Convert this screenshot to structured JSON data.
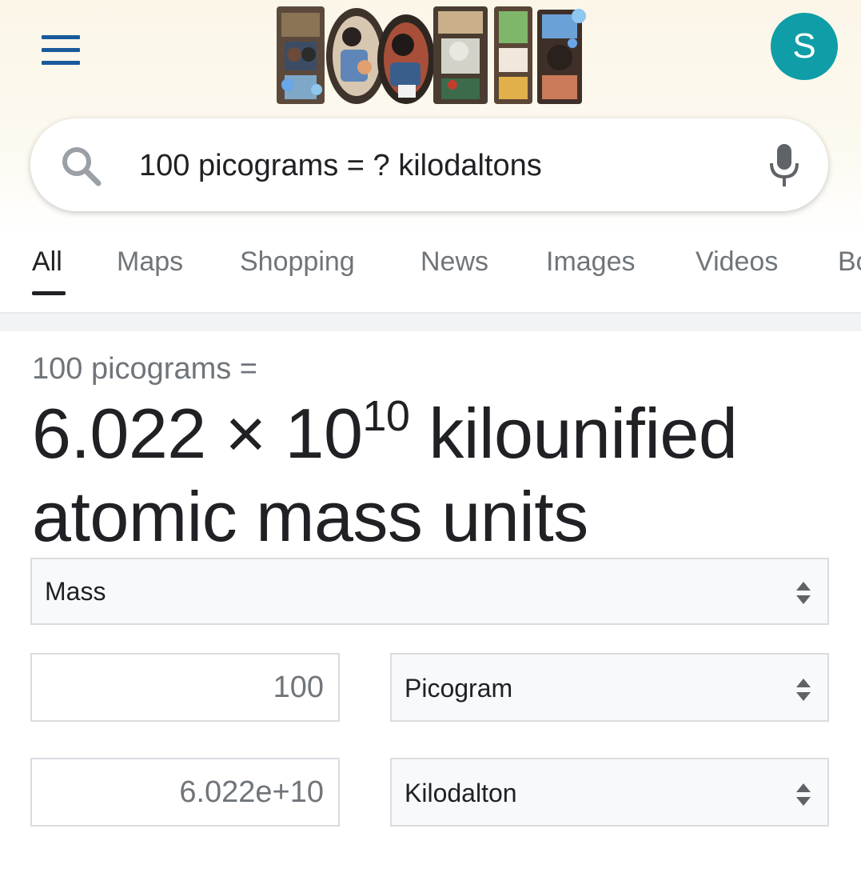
{
  "header": {
    "avatar_letter": "S"
  },
  "search": {
    "query": "100 picograms = ? kilodaltons"
  },
  "tabs": [
    {
      "label": "All"
    },
    {
      "label": "Maps"
    },
    {
      "label": "Shopping"
    },
    {
      "label": "News"
    },
    {
      "label": "Images"
    },
    {
      "label": "Videos"
    },
    {
      "label": "Bo"
    }
  ],
  "converter": {
    "result_label": "100 picograms =",
    "result_mantissa": "6.022 × 10",
    "result_exponent": "10",
    "result_unit_line1": " kilounified",
    "result_unit_line2": "atomic mass units",
    "category": "Mass",
    "from_value": "100",
    "from_unit": "Picogram",
    "to_value": "6.022e+10",
    "to_unit": "Kilodalton"
  },
  "colors": {
    "accent_blue": "#1a5a9b",
    "avatar_teal": "#0f9ea7"
  }
}
